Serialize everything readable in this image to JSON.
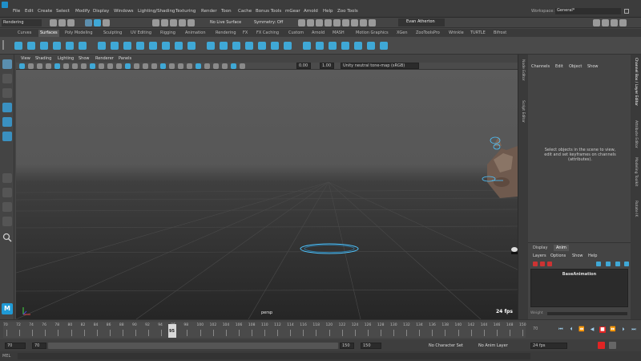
{
  "menubar": {
    "items": [
      "File",
      "Edit",
      "Create",
      "Select",
      "Modify",
      "Display",
      "Windows",
      "Lighting/Shading",
      "Texturing",
      "Render",
      "Toon",
      "Cache",
      "Bonus Tools",
      "mGear",
      "Arnold",
      "Help",
      "Zoo Tools"
    ],
    "workspace_label": "Workspace:",
    "workspace_value": "General*"
  },
  "statusline": {
    "mode_menu": "Rendering",
    "live_surface": "No Live Surface",
    "symmetry": "Symmetry: Off",
    "user": "Evan Atherton"
  },
  "shelf": {
    "tabs": [
      "Curves",
      "Surfaces",
      "Poly Modeling",
      "Sculpting",
      "UV Editing",
      "Rigging",
      "Animation",
      "Rendering",
      "FX",
      "FX Caching",
      "Custom",
      "Arnold",
      "MASH",
      "Motion Graphics",
      "XGen",
      "ZooToolsPro",
      "Wrinkle",
      "TURTLE",
      "Bifrost"
    ],
    "active_tab": "Surfaces"
  },
  "viewport": {
    "menu": [
      "View",
      "Shading",
      "Lighting",
      "Show",
      "Renderer",
      "Panels"
    ],
    "exposure": "0.00",
    "gamma": "1.00",
    "colorspace": "Unity neutral tone-map (sRGB)",
    "camera_label": "persp",
    "fps_label": "24 fps"
  },
  "side_panels": {
    "left_tabs": [
      "Node Editor",
      "Script Editor"
    ],
    "right_tabs": [
      "Channel Box / Layer Editor",
      "Attribute Editor",
      "Modeling Toolkit",
      "Rotate IK"
    ]
  },
  "channel_box": {
    "menu": [
      "Channels",
      "Edit",
      "Object",
      "Show"
    ],
    "message": "Select objects in the scene to view, edit and set keyframes on channels (attributes).",
    "layer_tabs": [
      "Display",
      "Anim"
    ],
    "active_layer_tab": "Anim",
    "layer_menu": [
      "Layers",
      "Options",
      "Show",
      "Help"
    ],
    "layer_name": "BaseAnimation",
    "weight_label": "Weight"
  },
  "timeline": {
    "ticks": [
      70,
      72,
      74,
      76,
      78,
      80,
      82,
      84,
      86,
      88,
      90,
      92,
      94,
      96,
      98,
      100,
      102,
      104,
      106,
      108,
      110,
      112,
      114,
      116,
      118,
      120,
      122,
      124,
      126,
      128,
      130,
      132,
      134,
      136,
      138,
      140,
      142,
      144,
      146,
      148,
      150
    ],
    "current_frame": "95",
    "current_field": "70"
  },
  "range_bar": {
    "start": "70",
    "anim_start": "70",
    "range_end": "150",
    "anim_end": "150",
    "character_set": "No Character Set",
    "anim_layer": "No Anim Layer",
    "fps": "24 fps"
  },
  "bottom": {
    "mel_label": "MEL"
  },
  "colors": {
    "accent": "#3fa8d6",
    "playhead": "#d9d9d9",
    "record": "#e02424"
  }
}
